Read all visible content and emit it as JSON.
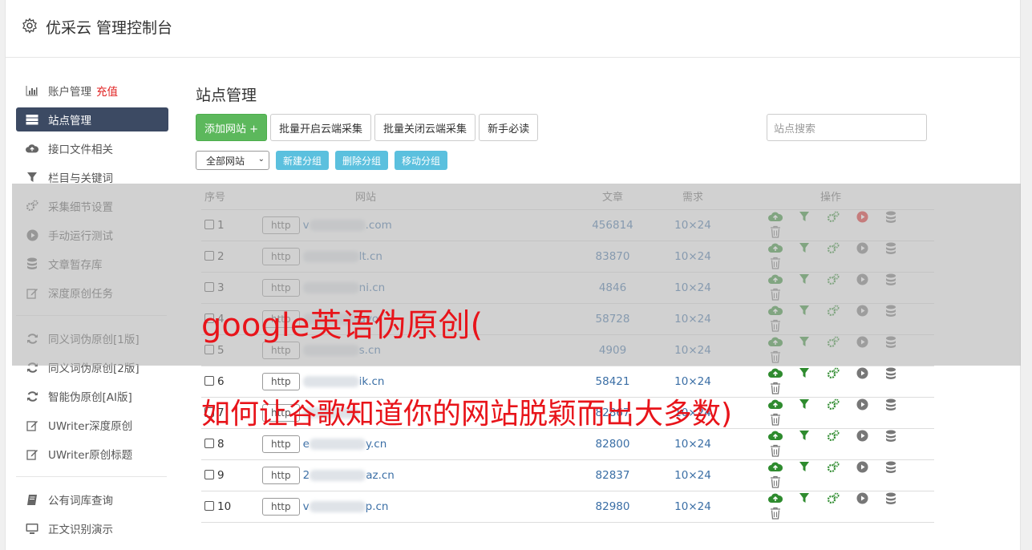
{
  "header": {
    "title": "优采云 管理控制台"
  },
  "sidebar": {
    "items": [
      {
        "label": "账户管理",
        "extra": "充值",
        "icon": "bar-chart-icon"
      },
      {
        "label": "站点管理",
        "icon": "server-icon",
        "active": true
      },
      {
        "label": "接口文件相关",
        "icon": "cloud-upload-icon"
      },
      {
        "label": "栏目与关键词",
        "icon": "filter-icon"
      },
      {
        "label": "采集细节设置",
        "icon": "gears-icon"
      },
      {
        "label": "手动运行测试",
        "icon": "play-circle-icon"
      },
      {
        "label": "文章暂存库",
        "icon": "database-icon"
      },
      {
        "label": "深度原创任务",
        "icon": "edit-icon"
      }
    ],
    "items2": [
      {
        "label": "同义词伪原创[1版]",
        "icon": "refresh-icon"
      },
      {
        "label": "同义词伪原创[2版]",
        "icon": "refresh-icon"
      },
      {
        "label": "智能伪原创[AI版]",
        "icon": "refresh-icon"
      },
      {
        "label": "UWriter深度原创",
        "icon": "edit-icon"
      },
      {
        "label": "UWriter原创标题",
        "icon": "edit-icon"
      }
    ],
    "items3": [
      {
        "label": "公有词库查询",
        "icon": "book-icon"
      },
      {
        "label": "正文识别演示",
        "icon": "monitor-icon"
      }
    ]
  },
  "main": {
    "title": "站点管理",
    "add_button": "添加网站 +",
    "batch_open": "批量开启云端采集",
    "batch_close": "批量关闭云端采集",
    "newbie": "新手必读",
    "search_placeholder": "站点搜索",
    "group_select": "全部网站",
    "new_group": "新建分组",
    "delete_group": "删除分组",
    "move_group": "移动分组",
    "columns": [
      "序号",
      "网站",
      "文章",
      "需求",
      "操作"
    ],
    "rows": [
      {
        "no": "1",
        "http": "http",
        "site_prefix": "v",
        "site_suffix": ".com",
        "articles": "456814",
        "req": "10×24",
        "running": true
      },
      {
        "no": "2",
        "http": "http",
        "site_prefix": "",
        "site_suffix": "lt.cn",
        "articles": "83870",
        "req": "10×24",
        "running": false
      },
      {
        "no": "3",
        "http": "http",
        "site_prefix": "",
        "site_suffix": "ni.cn",
        "articles": "4846",
        "req": "10×24",
        "running": false
      },
      {
        "no": "4",
        "http": "http",
        "site_prefix": "",
        "site_suffix": "ayo",
        "articles": "58728",
        "req": "10×24",
        "running": false
      },
      {
        "no": "5",
        "http": "http",
        "site_prefix": "",
        "site_suffix": "s.cn",
        "articles": "4909",
        "req": "10×24",
        "running": false
      },
      {
        "no": "6",
        "http": "http",
        "site_prefix": "",
        "site_suffix": "ik.cn",
        "articles": "58421",
        "req": "10×24",
        "running": false
      },
      {
        "no": "7",
        "http": "http",
        "site_prefix": "",
        "site_suffix": "",
        "articles": "82867",
        "req": "10×24",
        "running": false
      },
      {
        "no": "8",
        "http": "http",
        "site_prefix": "e",
        "site_suffix": "y.cn",
        "articles": "82800",
        "req": "10×24",
        "running": false
      },
      {
        "no": "9",
        "http": "http",
        "site_prefix": "2",
        "site_suffix": "az.cn",
        "articles": "82837",
        "req": "10×24",
        "running": false
      },
      {
        "no": "10",
        "http": "http",
        "site_prefix": "v",
        "site_suffix": "p.cn",
        "articles": "82980",
        "req": "10×24",
        "running": false
      }
    ]
  },
  "overlay": {
    "line1": "google英语伪原创(",
    "line2": "如何让谷歌知道你的网站脱颖而出大多数)"
  },
  "colors": {
    "sidebar_active": "#3c4a63",
    "green": "#5cb85c",
    "info": "#5bc0de",
    "link": "#3a6ea5",
    "red": "#e8141a"
  }
}
